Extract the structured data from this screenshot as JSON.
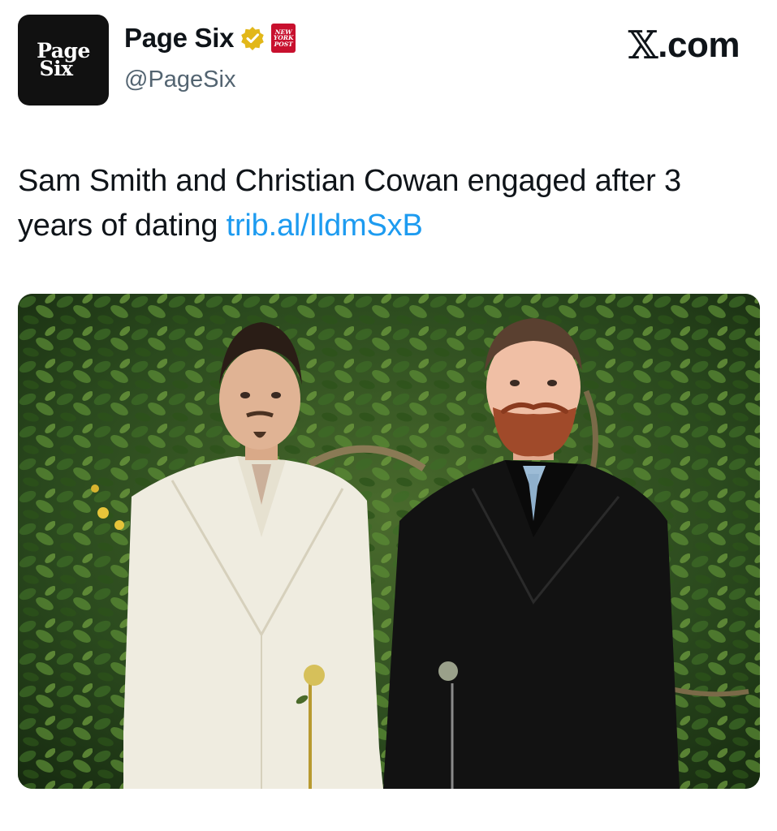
{
  "avatar": {
    "line1": "Page",
    "line2": "Six"
  },
  "account": {
    "display_name": "Page Six",
    "handle": "@PageSix",
    "verified": true,
    "verified_icon": "verified-badge-icon",
    "affiliate_badge": {
      "line1": "NEW",
      "line2": "YORK",
      "line3": "POST"
    }
  },
  "source": {
    "logo": "𝕏",
    "label": ".com"
  },
  "tweet": {
    "text": "Sam Smith and Christian Cowan engaged after 3 years of dating ",
    "link": "trib.al/IldmSxB"
  },
  "colors": {
    "link": "#1d9bf0",
    "verified_gold": "#e2b719",
    "nyp_red": "#c8102e"
  }
}
